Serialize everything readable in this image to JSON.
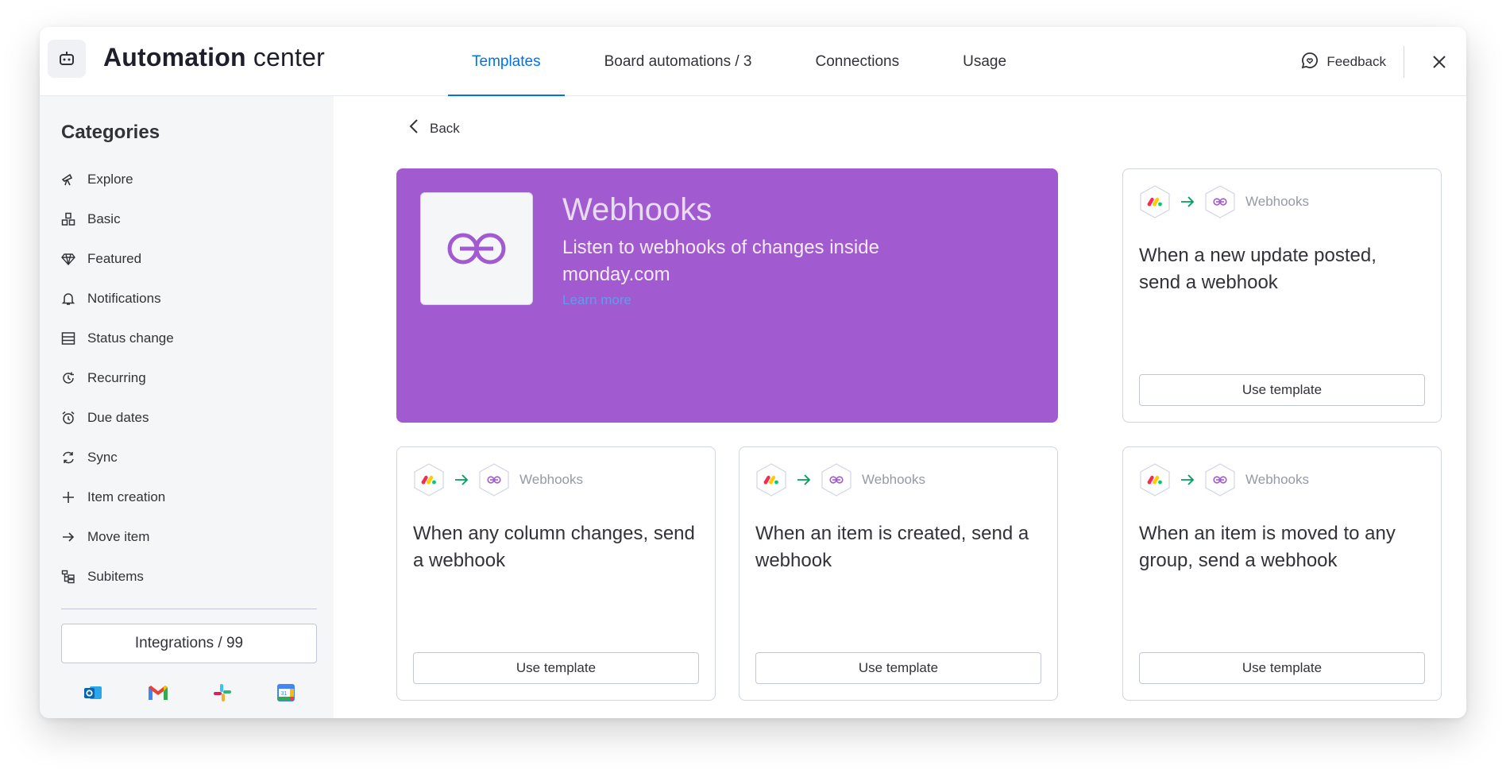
{
  "header": {
    "title_bold": "Automation",
    "title_rest": " center",
    "tabs": [
      {
        "label": "Templates"
      },
      {
        "label": "Board automations / 3"
      },
      {
        "label": "Connections"
      },
      {
        "label": "Usage"
      }
    ],
    "feedback_label": "Feedback"
  },
  "sidebar": {
    "title": "Categories",
    "items": [
      {
        "label": "Explore",
        "icon": "telescope-icon"
      },
      {
        "label": "Basic",
        "icon": "shapes-icon"
      },
      {
        "label": "Featured",
        "icon": "diamond-icon"
      },
      {
        "label": "Notifications",
        "icon": "bell-icon"
      },
      {
        "label": "Status change",
        "icon": "table-icon"
      },
      {
        "label": "Recurring",
        "icon": "recurring-icon"
      },
      {
        "label": "Due dates",
        "icon": "alarm-icon"
      },
      {
        "label": "Sync",
        "icon": "sync-icon"
      },
      {
        "label": "Item creation",
        "icon": "plus-icon"
      },
      {
        "label": "Move item",
        "icon": "arrow-right-icon"
      },
      {
        "label": "Subitems",
        "icon": "subitems-icon"
      }
    ],
    "integrations_label": "Integrations / 99",
    "integration_icons": [
      "outlook-icon",
      "gmail-icon",
      "slack-icon",
      "google-calendar-icon"
    ]
  },
  "main": {
    "back_label": "Back",
    "hero": {
      "title": "Webhooks",
      "description": "Listen to webhooks of changes inside monday.com",
      "link": "Learn more",
      "color": "#a25ad0"
    },
    "cards": [
      {
        "app": "Webhooks",
        "text": "When a new update posted, send a webhook",
        "button": "Use template"
      },
      {
        "app": "Webhooks",
        "text": "When any column changes, send a webhook",
        "button": "Use template"
      },
      {
        "app": "Webhooks",
        "text": "When an item is created, send a webhook",
        "button": "Use template"
      },
      {
        "app": "Webhooks",
        "text": "When an item is moved to any group, send a webhook",
        "button": "Use template"
      }
    ]
  },
  "colors": {
    "accent": "#0073ea",
    "arrow": "#00a05a"
  }
}
